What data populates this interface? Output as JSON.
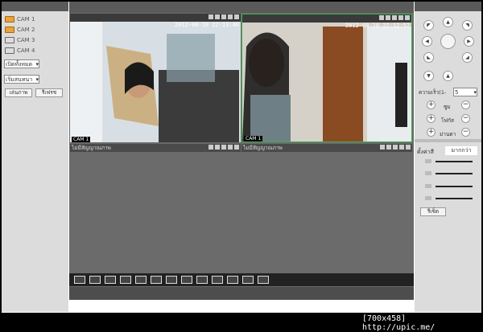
{
  "cameras": [
    "CAM 1",
    "CAM 2",
    "CAM 3",
    "CAM 4"
  ],
  "left": {
    "select_open": "เปิดทั้งหมด",
    "select_stream": "เริ่มสนทนา",
    "btn_play": "เล่นภาพ",
    "btn_record": "รีเฟรช"
  },
  "panes": [
    {
      "timestamp": "2012-08-18 22:13:40",
      "label": "CAM 1",
      "no_video": ""
    },
    {
      "timestamp": "2012-08-18 22:12:57",
      "label": "CAM 1",
      "no_video": ""
    },
    {
      "timestamp": "",
      "label": "",
      "no_video": "ไม่มีสัญญาณภาพ"
    },
    {
      "timestamp": "",
      "label": "",
      "no_video": "ไม่มีสัญญาณภาพ"
    }
  ],
  "ptz": {
    "speed_label": "ความเร็ว(1-",
    "speed_value": "5",
    "zoom": "ซูม",
    "focus": "โฟกัส",
    "iris": "ม่านตา",
    "tab_settings": "ตั้งค่าสี",
    "tab_more": "มากกว่า",
    "refresh": "รีเซ็ต"
  },
  "watermark": "[700x458] http://upic.me/"
}
